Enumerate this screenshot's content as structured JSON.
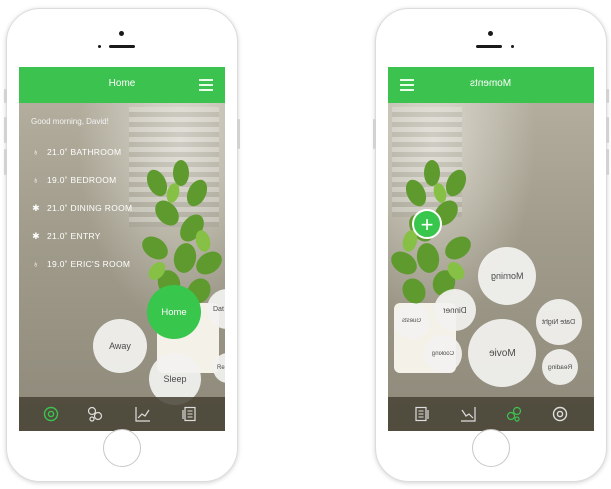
{
  "left_phone": {
    "title": "Home",
    "greeting": "Good morning, David!",
    "rooms": [
      {
        "temp": "21.0˚",
        "name": "BATHROOM",
        "icon": "lightbulb-outline"
      },
      {
        "temp": "19.0˚",
        "name": "BEDROOM",
        "icon": "lightbulb-outline"
      },
      {
        "temp": "21.0˚",
        "name": "DINING ROOM",
        "icon": "lightbulb-on"
      },
      {
        "temp": "21.0˚",
        "name": "ENTRY",
        "icon": "lightbulb-on"
      },
      {
        "temp": "19.0˚",
        "name": "ERIC'S ROOM",
        "icon": "lightbulb-outline"
      }
    ],
    "moments": {
      "home": "Home",
      "away": "Away",
      "sleep": "Sleep",
      "date_partial": "Dat",
      "re_partial": "Re"
    },
    "tabs": [
      "home-tab",
      "devices-tab",
      "stats-tab",
      "notes-tab"
    ]
  },
  "right_phone": {
    "title": "Moments",
    "moments": {
      "morning": "Morning",
      "dinner": "Dinner",
      "guests": "Guests",
      "date_night": "Date Night",
      "cooking": "Cooking",
      "movie": "Movie",
      "reading": "Reading"
    },
    "add_symbol": "+",
    "tabs": [
      "notes-tab",
      "stats-tab",
      "devices-tab",
      "home-tab"
    ]
  },
  "colors": {
    "accent": "#3cc24f",
    "bubble": "#f2f2f0",
    "text_dark": "#4a4a4a"
  }
}
